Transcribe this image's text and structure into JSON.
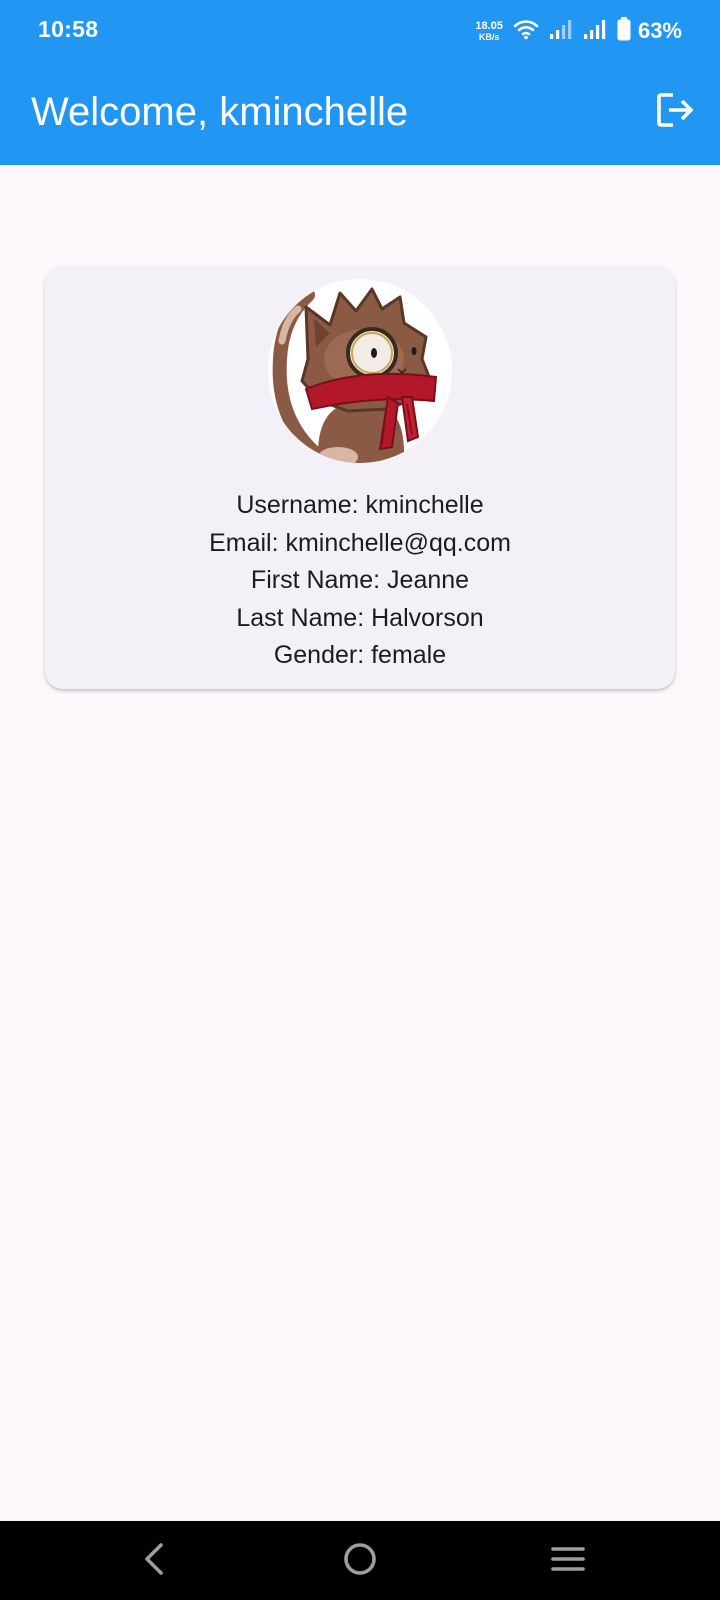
{
  "status_bar": {
    "time": "10:58",
    "net_speed_value": "18.05",
    "net_speed_unit": "KB/s",
    "battery_percent": "63%",
    "icons": [
      "wifi-icon",
      "signal-icon",
      "signal-icon",
      "battery-icon"
    ]
  },
  "app_bar": {
    "title": "Welcome, kminchelle",
    "action_icon": "logout-icon",
    "background_color": "#2196f3"
  },
  "profile": {
    "avatar": "cat-avatar",
    "username_line": "Username: kminchelle",
    "email_line": "Email: kminchelle@qq.com",
    "first_name_line": "First Name: Jeanne",
    "last_name_line": "Last Name: Halvorson",
    "gender_line": "Gender: female"
  },
  "nav_bar": {
    "buttons": [
      "back-icon",
      "home-icon",
      "recents-menu-icon"
    ]
  }
}
